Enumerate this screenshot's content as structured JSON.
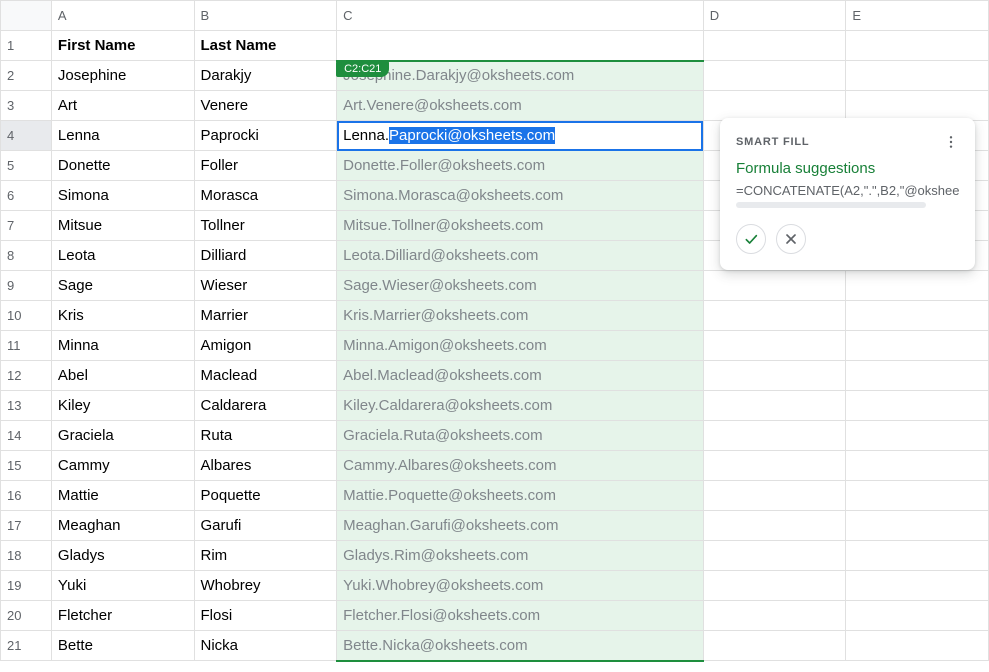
{
  "columns": [
    "A",
    "B",
    "C",
    "D",
    "E"
  ],
  "headers": {
    "first_name": "First Name",
    "last_name": "Last Name"
  },
  "range_badge": "C2:C21",
  "active_cell": {
    "row_index": 2,
    "plain": "Lenna.",
    "highlight": "Paprocki@oksheets.com"
  },
  "rows": [
    {
      "num": "1"
    },
    {
      "num": "2",
      "first": "Josephine",
      "last": "Darakjy",
      "email": "Josephine.Darakjy@oksheets.com"
    },
    {
      "num": "3",
      "first": "Art",
      "last": "Venere",
      "email": "Art.Venere@oksheets.com"
    },
    {
      "num": "4",
      "first": "Lenna",
      "last": "Paprocki",
      "email": "Lenna.Paprocki@oksheets.com"
    },
    {
      "num": "5",
      "first": "Donette",
      "last": "Foller",
      "email": "Donette.Foller@oksheets.com"
    },
    {
      "num": "6",
      "first": "Simona",
      "last": "Morasca",
      "email": "Simona.Morasca@oksheets.com"
    },
    {
      "num": "7",
      "first": "Mitsue",
      "last": "Tollner",
      "email": "Mitsue.Tollner@oksheets.com"
    },
    {
      "num": "8",
      "first": "Leota",
      "last": "Dilliard",
      "email": "Leota.Dilliard@oksheets.com"
    },
    {
      "num": "9",
      "first": "Sage",
      "last": "Wieser",
      "email": "Sage.Wieser@oksheets.com"
    },
    {
      "num": "10",
      "first": "Kris",
      "last": "Marrier",
      "email": "Kris.Marrier@oksheets.com"
    },
    {
      "num": "11",
      "first": "Minna",
      "last": "Amigon",
      "email": "Minna.Amigon@oksheets.com"
    },
    {
      "num": "12",
      "first": "Abel",
      "last": "Maclead",
      "email": "Abel.Maclead@oksheets.com"
    },
    {
      "num": "13",
      "first": "Kiley",
      "last": "Caldarera",
      "email": "Kiley.Caldarera@oksheets.com"
    },
    {
      "num": "14",
      "first": "Graciela",
      "last": "Ruta",
      "email": "Graciela.Ruta@oksheets.com"
    },
    {
      "num": "15",
      "first": "Cammy",
      "last": "Albares",
      "email": "Cammy.Albares@oksheets.com"
    },
    {
      "num": "16",
      "first": "Mattie",
      "last": "Poquette",
      "email": "Mattie.Poquette@oksheets.com"
    },
    {
      "num": "17",
      "first": "Meaghan",
      "last": "Garufi",
      "email": "Meaghan.Garufi@oksheets.com"
    },
    {
      "num": "18",
      "first": "Gladys",
      "last": "Rim",
      "email": "Gladys.Rim@oksheets.com"
    },
    {
      "num": "19",
      "first": "Yuki",
      "last": "Whobrey",
      "email": "Yuki.Whobrey@oksheets.com"
    },
    {
      "num": "20",
      "first": "Fletcher",
      "last": "Flosi",
      "email": "Fletcher.Flosi@oksheets.com"
    },
    {
      "num": "21",
      "first": "Bette",
      "last": "Nicka",
      "email": "Bette.Nicka@oksheets.com"
    }
  ],
  "smart_fill": {
    "title": "SMART FILL",
    "subtitle": "Formula suggestions",
    "formula": "=CONCATENATE(A2,\".\",B2,\"@okshee"
  }
}
